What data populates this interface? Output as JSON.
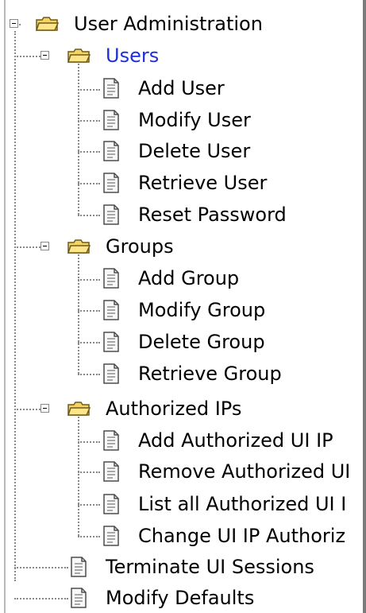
{
  "tree": {
    "root": {
      "label": "User Administration",
      "children": {
        "users": {
          "label": "Users",
          "items": [
            "Add User",
            "Modify User",
            "Delete User",
            "Retrieve User",
            "Reset Password"
          ]
        },
        "groups": {
          "label": "Groups",
          "items": [
            "Add Group",
            "Modify Group",
            "Delete Group",
            "Retrieve Group"
          ]
        },
        "authorized_ips": {
          "label": "Authorized IPs",
          "items": [
            "Add Authorized UI IP",
            "Remove Authorized UI",
            "List all Authorized UI I",
            "Change UI IP Authoriz"
          ]
        },
        "terminate": {
          "label": "Terminate UI Sessions"
        },
        "modify_defaults": {
          "label": "Modify Defaults"
        }
      }
    }
  }
}
